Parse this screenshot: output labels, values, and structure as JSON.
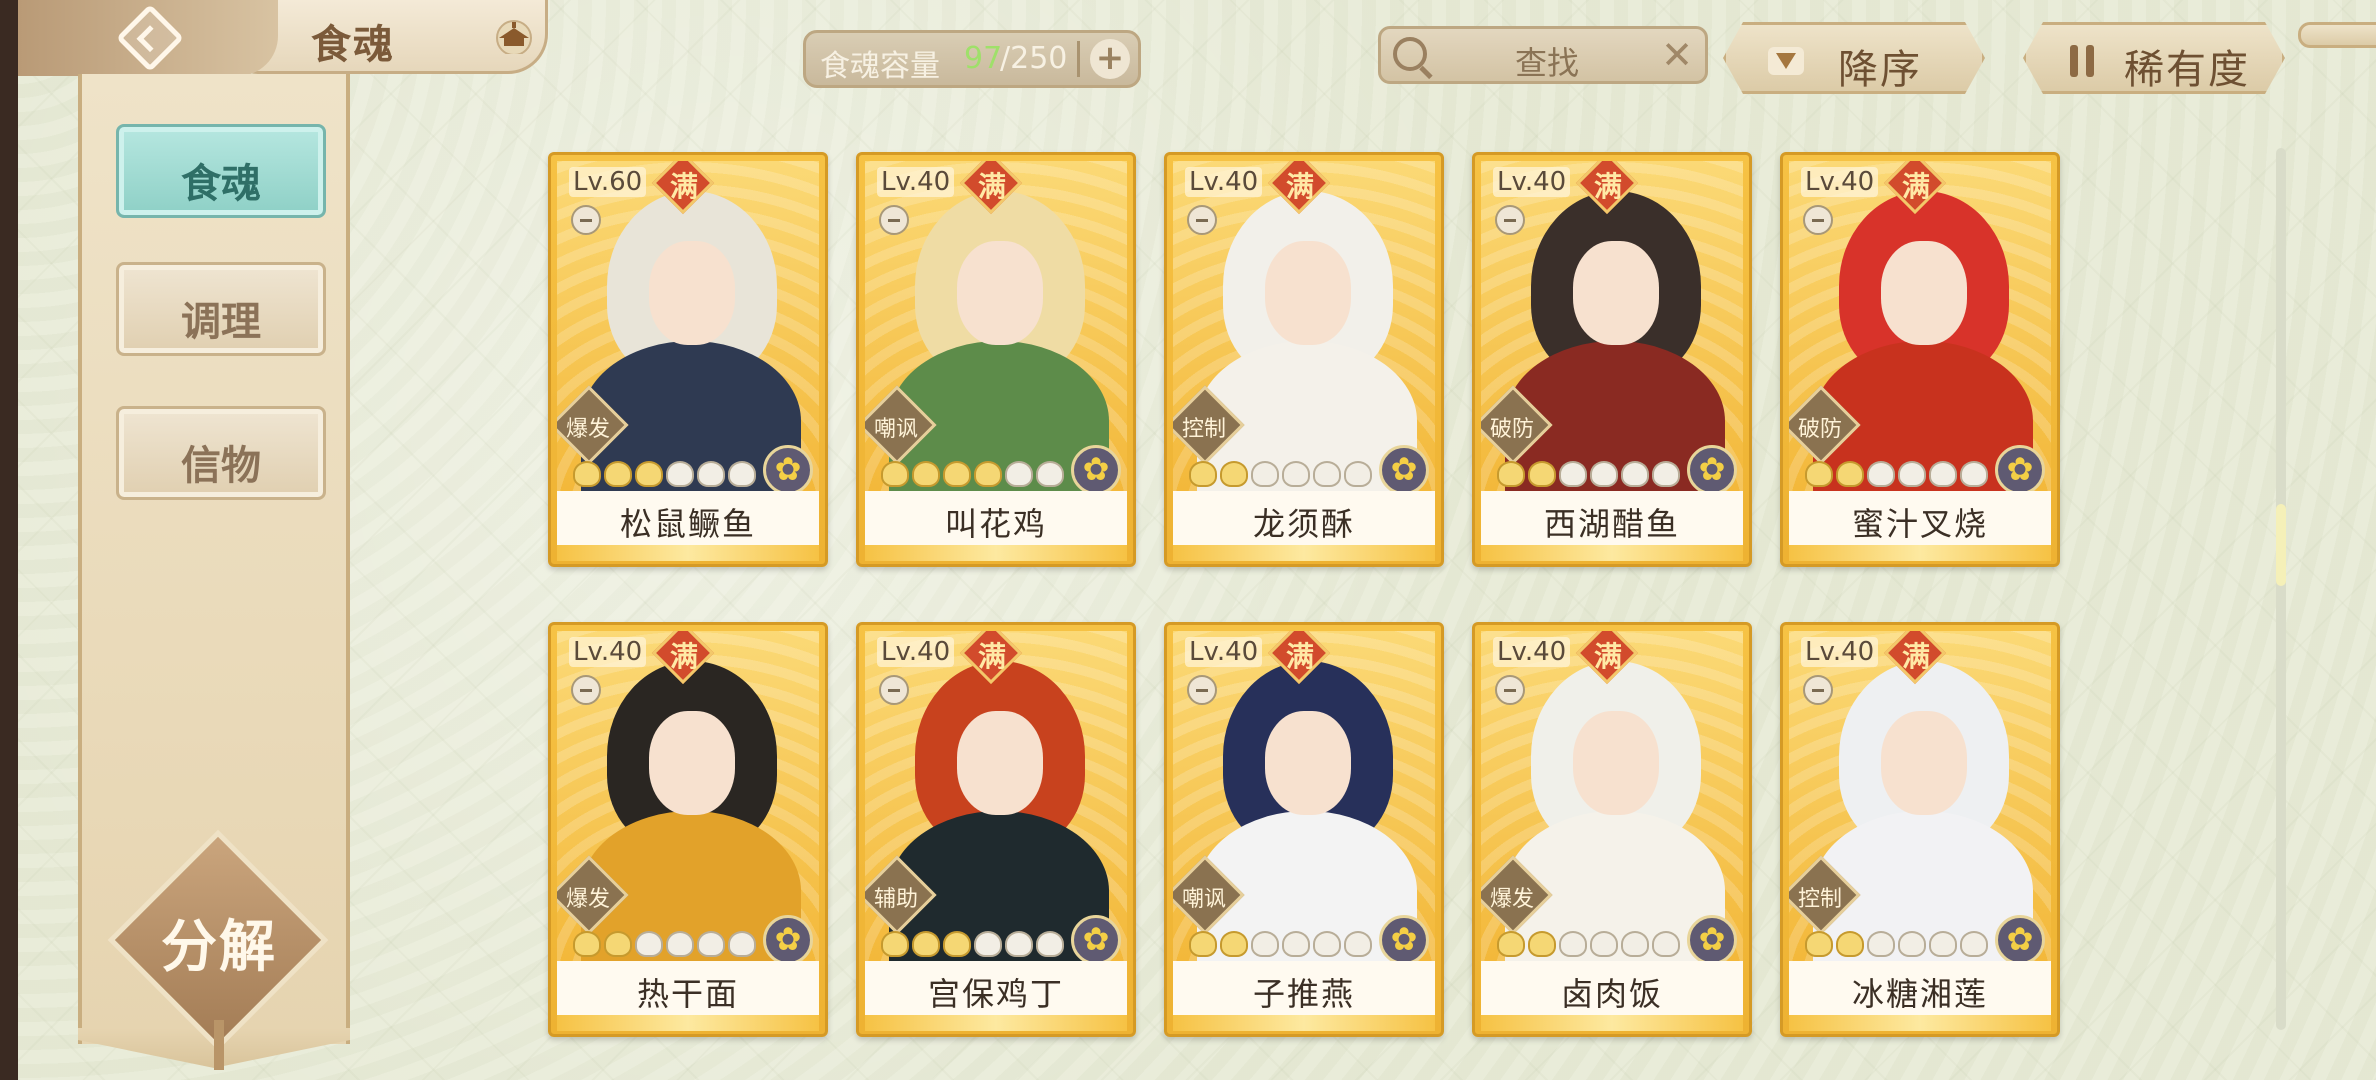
{
  "header": {
    "title": "食魂",
    "back_icon": "back-arrow-icon",
    "home_icon": "pavilion-icon"
  },
  "capacity": {
    "label": "食魂容量",
    "current": "97",
    "max": "/250",
    "plus": "+"
  },
  "search": {
    "placeholder": "查找",
    "clear": "✕"
  },
  "sort": {
    "order_label": "降序",
    "rarity_label": "稀有度"
  },
  "sidebar": {
    "tabs": [
      {
        "label": "食魂",
        "active": true
      },
      {
        "label": "调理",
        "active": false
      },
      {
        "label": "信物",
        "active": false
      }
    ],
    "decompose_label": "分解"
  },
  "colors": {
    "accent_teal": "#8ed0c6",
    "card_gold": "#f6c244",
    "capacity_current": "#9fe06a",
    "max_badge": "#d24b2c"
  },
  "max_label": "满",
  "cards": [
    {
      "level": "Lv.60",
      "name": "松鼠鳜鱼",
      "role": "爆发",
      "stars": 3,
      "hair": "#e8e4d8",
      "outfit": "#2f3a52"
    },
    {
      "level": "Lv.40",
      "name": "叫花鸡",
      "role": "嘲讽",
      "stars": 4,
      "hair": "#efdca4",
      "outfit": "#5d8c4a"
    },
    {
      "level": "Lv.40",
      "name": "龙须酥",
      "role": "控制",
      "stars": 2,
      "hair": "#f2f0ea",
      "outfit": "#f4f1ea"
    },
    {
      "level": "Lv.40",
      "name": "西湖醋鱼",
      "role": "破防",
      "stars": 2,
      "hair": "#3a2f2a",
      "outfit": "#8a2a22"
    },
    {
      "level": "Lv.40",
      "name": "蜜汁叉烧",
      "role": "破防",
      "stars": 2,
      "hair": "#d8332a",
      "outfit": "#c8321e"
    },
    {
      "level": "Lv.40",
      "name": "热干面",
      "role": "爆发",
      "stars": 2,
      "hair": "#2a2622",
      "outfit": "#e2a22a"
    },
    {
      "level": "Lv.40",
      "name": "宫保鸡丁",
      "role": "辅助",
      "stars": 3,
      "hair": "#c8421e",
      "outfit": "#1f2a2e"
    },
    {
      "level": "Lv.40",
      "name": "子推燕",
      "role": "嘲讽",
      "stars": 2,
      "hair": "#27305a",
      "outfit": "#f3f3f3"
    },
    {
      "level": "Lv.40",
      "name": "卤肉饭",
      "role": "爆发",
      "stars": 2,
      "hair": "#f0f0ea",
      "outfit": "#f5f2ea"
    },
    {
      "level": "Lv.40",
      "name": "冰糖湘莲",
      "role": "控制",
      "stars": 2,
      "hair": "#eef0f2",
      "outfit": "#f2f2f4"
    }
  ]
}
